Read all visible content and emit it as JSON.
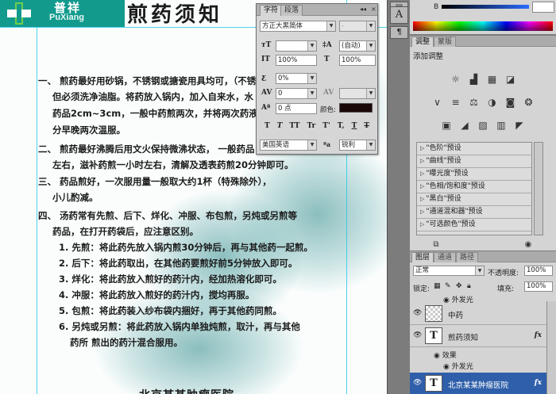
{
  "document": {
    "logo": {
      "cn": "普祥",
      "en": "PuXiang"
    },
    "title": "煎药须知",
    "lines": [
      "一、 煎药最好用砂锅，不锈钢或搪瓷用具均可，（不锈",
      "但必须洗净油脂。将药放入锅内，加入自来水，水",
      "药品2cm~3cm，一般中药煎两次，并将两次药液",
      "分早晚两次温服。",
      "二、 煎药最好沸腾后用文火保持微沸状态， 一般药品",
      "左右，滋补药煎一小时左右，清解及透表药煎20分钟即可。",
      "三、 药品煎好，一次服用量一般取大约1杯（特殊除外），",
      "小儿酌减。",
      "四、 汤药常有先煎、后下、烊化、冲服、布包煎，另炖或另煎等",
      "药品，在打开药袋后，应注意区别。",
      "1. 先煎：将此药先放入锅内煎30分钟后，再与其他药一起煎。",
      "2. 后下：将此药取出，在其他药要煎好前5分钟放入即可。",
      "3. 烊化：将此药放入煎好的药汁内，经加热溶化即可。",
      "4. 冲服：将此药放入煎好的药汁内，搅均再服。",
      "5. 包煎：将此药装入纱布袋内捆好，再于其他药同煎。",
      "6. 另炖或另煎：将此药放入锅内单独炖煎，取汁，再与其他",
      "药所 煎出的药汁混合服用。"
    ],
    "footer": "北京某某肿瘤医院"
  },
  "character_panel": {
    "tabs": [
      "字符",
      "段落"
    ],
    "active_tab": 0,
    "font_family": "方正大黑简体",
    "font_style": "-",
    "font_size": "",
    "leading": "(自动)",
    "vertical_scale": "100%",
    "horizontal_scale": "100%",
    "tracking_percent": "0%",
    "kerning": "0",
    "tracking": "",
    "baseline_shift": "0 点",
    "color_label": "颜色:",
    "text_color": "#1a0707",
    "style_buttons": [
      "T",
      "T",
      "TT",
      "Tr",
      "T'",
      "T,",
      "T",
      "T"
    ],
    "language": "美国英语",
    "antialias": "锐利",
    "aa_label": "ªa"
  },
  "color_panel": {
    "channel_label": "B",
    "channel_value": ""
  },
  "adjustments_panel": {
    "tabs": [
      "调整",
      "蒙版"
    ],
    "active_tab": 0,
    "title": "添加调整",
    "presets": [
      "\"色阶\"预设",
      "\"曲线\"预设",
      "\"曝光度\"预设",
      "\"色相/饱和度\"预设",
      "\"黑白\"预设",
      "\"通道混和器\"预设",
      "\"可选颜色\"预设"
    ]
  },
  "layers_panel": {
    "tabs": [
      "图层",
      "通道",
      "路径"
    ],
    "active_tab": 0,
    "blend_mode": "正常",
    "opacity_label": "不透明度:",
    "opacity": "100%",
    "lock_label": "锁定:",
    "fill_label": "填充:",
    "fill": "100%",
    "partial_effect": "外发光",
    "layers": [
      {
        "name": "中药",
        "kind": "raster",
        "fx": ""
      },
      {
        "name": "煎药须知",
        "kind": "text",
        "fx": "fx"
      },
      {
        "name": "北京某某肿瘤医院",
        "kind": "text",
        "fx": "fx"
      }
    ],
    "effects_label": "效果",
    "outer_glow": "外发光"
  }
}
